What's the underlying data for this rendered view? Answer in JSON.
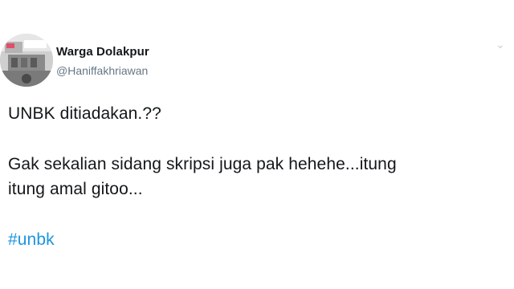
{
  "tweet": {
    "display_name": "Warga Dolakpur",
    "handle": "@Haniffakhriawan",
    "lines": {
      "l1": "UNBK ditiadakan.??",
      "l2": "Gak sekalian sidang skripsi juga pak hehehe...itung",
      "l3": "itung amal gitoo..."
    },
    "hashtag": "#unbk"
  },
  "colors": {
    "text": "#14171a",
    "handle": "#657786",
    "link": "#1b95e0"
  },
  "icons": {
    "avatar": "profile-photo",
    "more": "more-options-icon"
  }
}
